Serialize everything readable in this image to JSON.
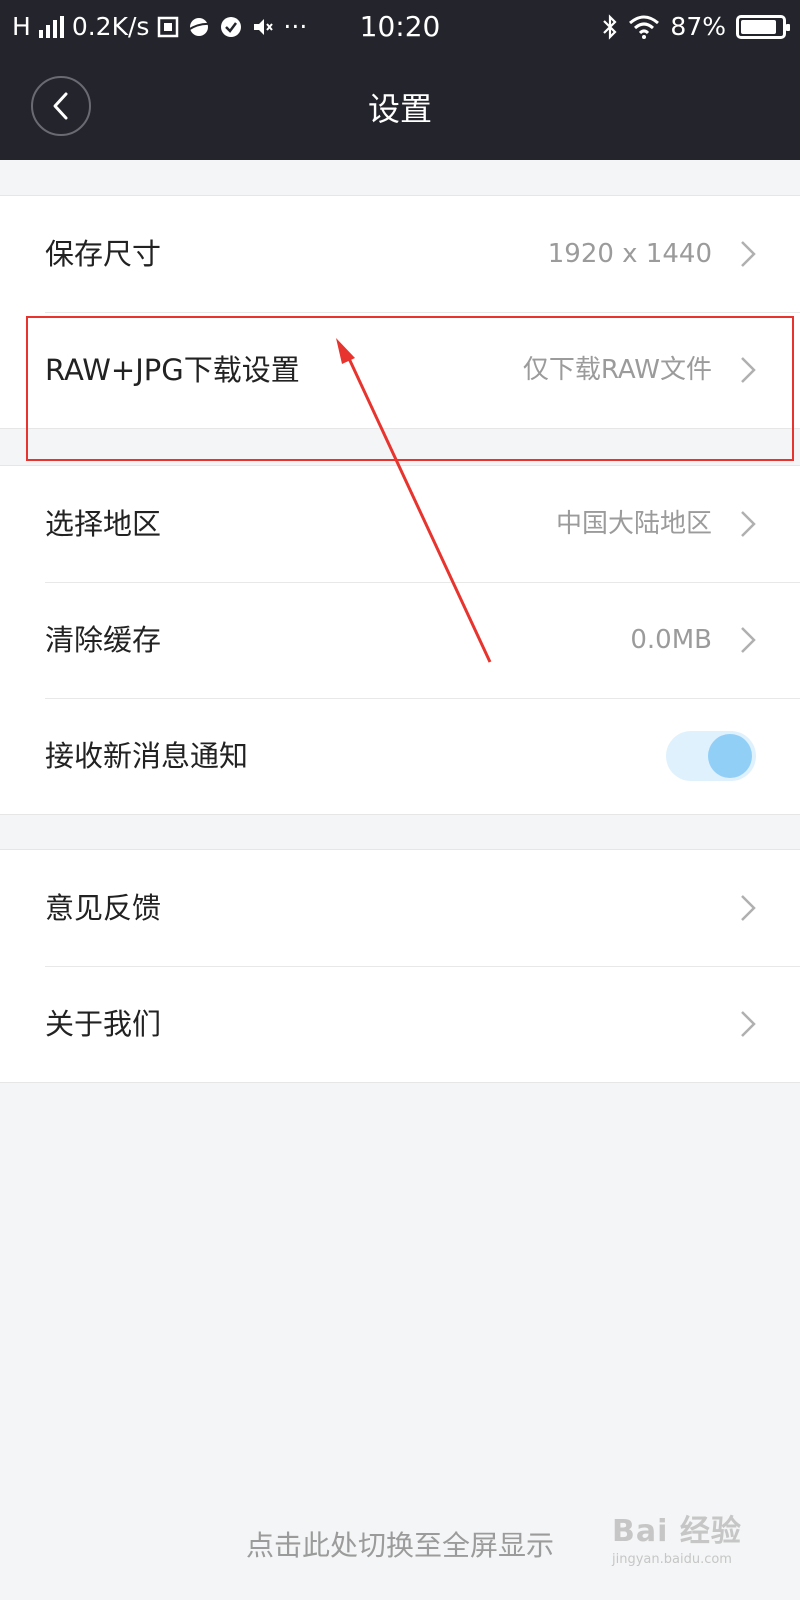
{
  "status_bar": {
    "carrier": "H",
    "net_speed": "0.2K/s",
    "more": "···",
    "time": "10:20",
    "battery": "87%",
    "battery_level": 0.87
  },
  "header": {
    "title": "设置"
  },
  "settings": {
    "group1": [
      {
        "label": "保存尺寸",
        "value": "1920 x 1440"
      },
      {
        "label": "RAW+JPG下载设置",
        "value": "仅下载RAW文件"
      }
    ],
    "group2": [
      {
        "label": "选择地区",
        "value": "中国大陆地区"
      },
      {
        "label": "清除缓存",
        "value": "0.0MB"
      },
      {
        "label": "接收新消息通知",
        "toggle_on": true
      }
    ],
    "group3": [
      {
        "label": "意见反馈"
      },
      {
        "label": "关于我们"
      }
    ]
  },
  "footer": {
    "fullscreen_link": "点击此处切换至全屏显示"
  },
  "watermark": {
    "logo": "Bai 经验",
    "url": "jingyan.baidu.com"
  },
  "colors": {
    "header_bg": "#24252c",
    "highlight": "#e8342e",
    "toggle_knob": "#92cff7",
    "toggle_track": "#dff1fd"
  }
}
